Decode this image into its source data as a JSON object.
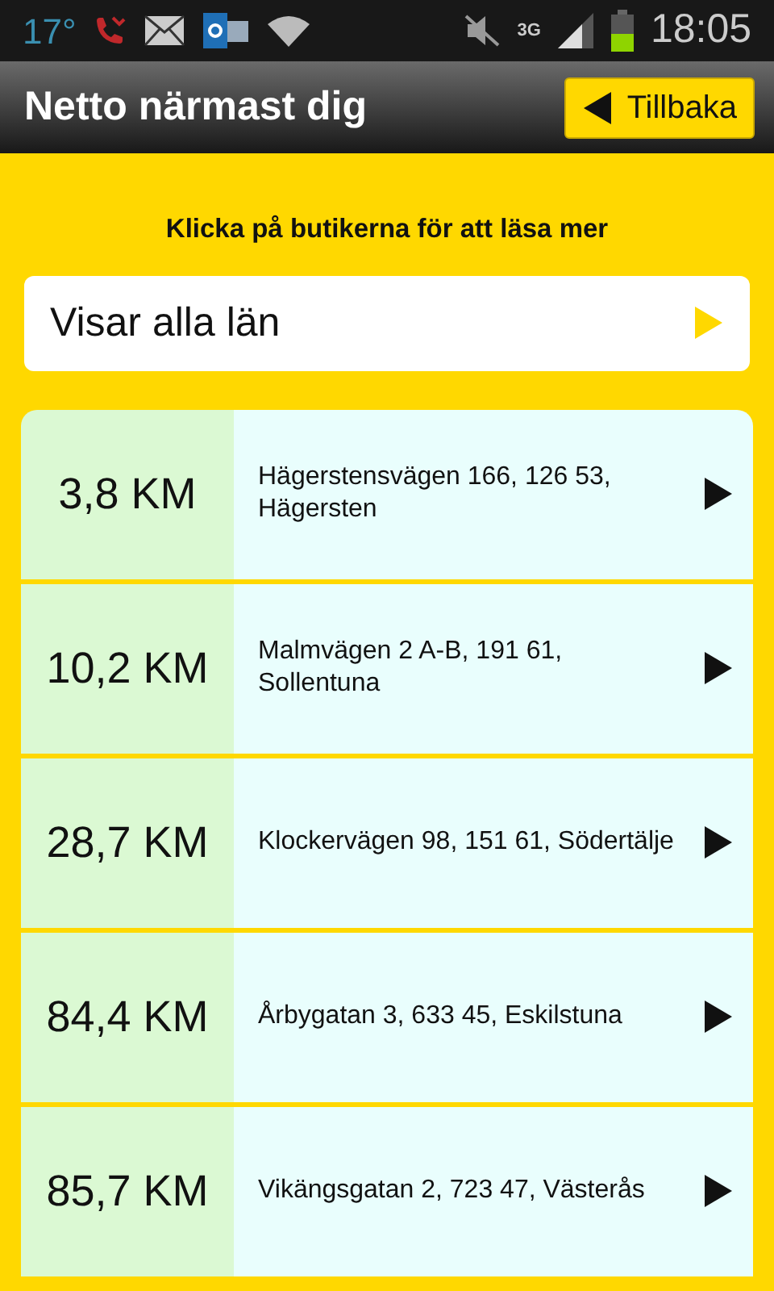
{
  "status_bar": {
    "temperature": "17°",
    "network": "3G",
    "time": "18:05"
  },
  "header": {
    "title": "Netto närmast dig",
    "back_button": "Tillbaka"
  },
  "instruction": "Klicka på butikerna för att läsa mer",
  "region_selector": {
    "value": "Visar alla län"
  },
  "stores": [
    {
      "distance": "3,8 KM",
      "address": "Hägerstensvägen 166, 126 53, Hägersten"
    },
    {
      "distance": "10,2 KM",
      "address": "Malmvägen 2 A-B, 191 61, Sollentuna"
    },
    {
      "distance": "28,7 KM",
      "address": "Klockervägen 98, 151 61, Södertälje"
    },
    {
      "distance": "84,4 KM",
      "address": "Årbygatan 3, 633 45, Eskilstuna"
    },
    {
      "distance": "85,7 KM",
      "address": "Vikängsgatan 2, 723 47, Västerås"
    }
  ]
}
